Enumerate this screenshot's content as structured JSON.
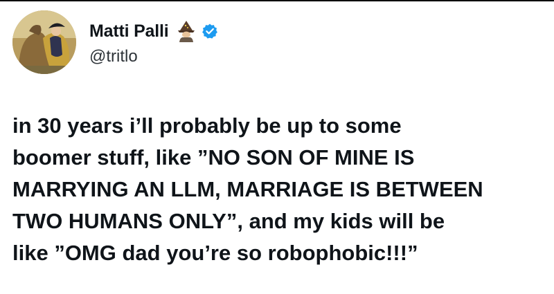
{
  "tweet": {
    "author": {
      "display_name": "Matti Palli",
      "handle": "@tritlo",
      "name_emoji": "mage-emoji-icon",
      "verified": true,
      "verified_color": "#1d9bf0"
    },
    "text_lines": [
      "in 30 years i’ll probably be up to some",
      "boomer stuff, like ”NO SON OF MINE IS",
      "MARRYING AN LLM, MARRIAGE IS BETWEEN",
      "TWO HUMANS ONLY”, and my kids will be",
      "like ”OMG dad you’re so robophobic!!!”"
    ]
  }
}
